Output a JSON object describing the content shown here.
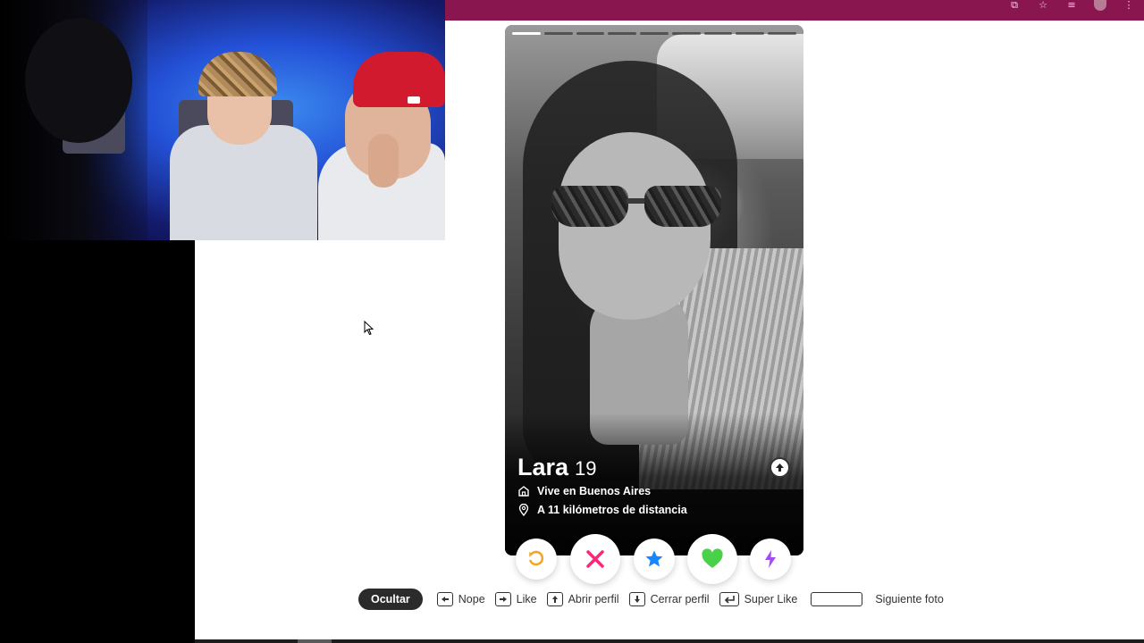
{
  "browser": {
    "toolbar_icons": [
      "install-icon",
      "star-icon",
      "playlist-icon",
      "profile-avatar",
      "menu-kebab-icon"
    ],
    "accent_color": "#8a1650"
  },
  "webcam": {
    "description_icon": "webcam-overlay"
  },
  "card": {
    "progress_segments": 9,
    "active_segment": 0,
    "name": "Lara",
    "age": "19",
    "location": "Vive en Buenos Aires",
    "distance": "A 11 kilómetros de distancia",
    "location_icon": "home-icon",
    "distance_icon": "map-pin-icon",
    "open_profile_icon": "arrow-up-icon"
  },
  "actions": [
    {
      "name": "rewind-button",
      "icon": "rewind-icon",
      "color": "#f5a623"
    },
    {
      "name": "nope-button",
      "icon": "close-icon",
      "color": "#fd267a"
    },
    {
      "name": "super-like-button",
      "icon": "star-icon",
      "color": "#1786ff"
    },
    {
      "name": "like-button",
      "icon": "heart-icon",
      "color": "#4ad14a"
    },
    {
      "name": "boost-button",
      "icon": "lightning-icon",
      "color": "#a14cf5"
    }
  ],
  "shortcuts": {
    "hide_label": "Ocultar",
    "nope": "Nope",
    "like": "Like",
    "open_profile": "Abrir perfil",
    "close_profile": "Cerrar perfil",
    "super_like": "Super Like",
    "next_photo": "Siguiente foto"
  }
}
